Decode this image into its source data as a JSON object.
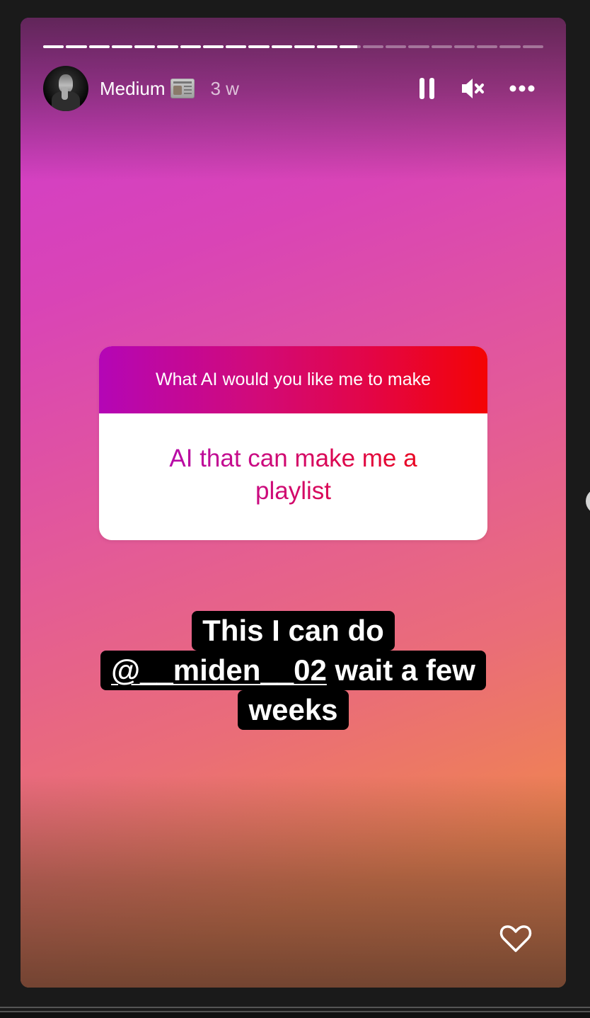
{
  "story": {
    "progress": {
      "total_segments": 22,
      "completed_segments": 13,
      "current_segment_fraction": 0.85
    },
    "header": {
      "username": "Medium",
      "username_emoji": "newspaper-icon",
      "time_ago": "3 w",
      "controls": [
        {
          "name": "pause-icon",
          "label": "Pause"
        },
        {
          "name": "muted-icon",
          "label": "Unmute"
        },
        {
          "name": "more-options-icon",
          "label": "Menu"
        }
      ]
    },
    "question_sticker": {
      "question": "What AI would you like me to make",
      "answer": "AI that can make me a playlist"
    },
    "caption": {
      "line1": "This I can do",
      "mention": "@__miden__02",
      "line2_rest": " wait a few",
      "line3": "weeks"
    },
    "colors": {
      "background_top_left": "#cf3ccf",
      "background_bottom_right": "#ef8352",
      "sticker_gradient_start": "#b406b6",
      "sticker_gradient_end": "#f40404",
      "page_background": "#1a1a1a"
    },
    "like_icon": "heart-outline-icon"
  }
}
